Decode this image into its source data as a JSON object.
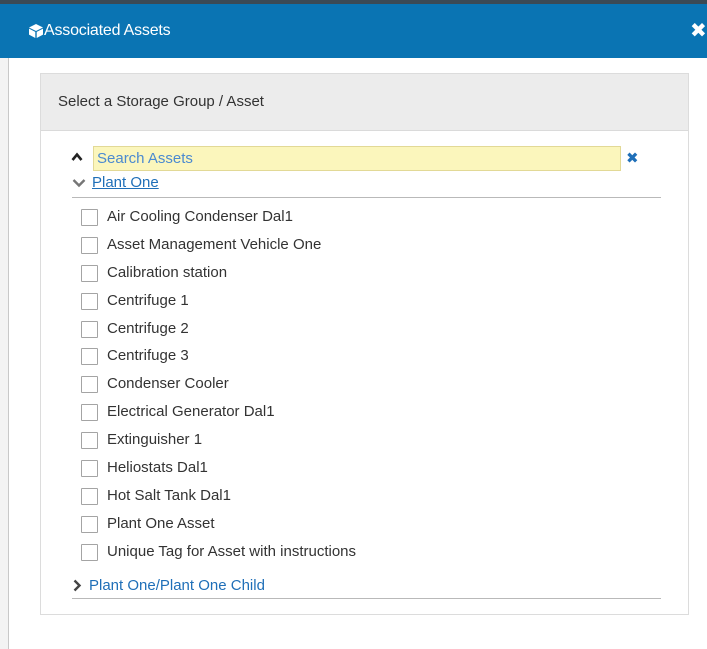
{
  "dialog": {
    "title": "Associated Assets",
    "title_icon": "cube-icon",
    "close_icon": "close-icon"
  },
  "panel": {
    "header": "Select a Storage Group / Asset"
  },
  "search": {
    "placeholder": "Search Assets",
    "value": ""
  },
  "groups": {
    "expanded": {
      "label": "Plant One",
      "expanded": true
    },
    "collapsed": {
      "label": "Plant One/Plant One Child",
      "expanded": false
    }
  },
  "assets": [
    {
      "label": "Air Cooling Condenser Dal1",
      "checked": false
    },
    {
      "label": "Asset Management Vehicle One",
      "checked": false
    },
    {
      "label": "Calibration station",
      "checked": false
    },
    {
      "label": "Centrifuge 1",
      "checked": false
    },
    {
      "label": "Centrifuge 2",
      "checked": false
    },
    {
      "label": "Centrifuge 3",
      "checked": false
    },
    {
      "label": "Condenser Cooler",
      "checked": false
    },
    {
      "label": "Electrical Generator Dal1",
      "checked": false
    },
    {
      "label": "Extinguisher 1",
      "checked": false
    },
    {
      "label": "Heliostats Dal1",
      "checked": false
    },
    {
      "label": "Hot Salt Tank Dal1",
      "checked": false
    },
    {
      "label": "Plant One Asset",
      "checked": false
    },
    {
      "label": "Unique Tag for Asset with instructions",
      "checked": false
    }
  ],
  "colors": {
    "titlebar": "#0a74b3",
    "link": "#1f6fb8",
    "search_bg": "#fbf6bc",
    "panel_header_bg": "#ececec"
  }
}
